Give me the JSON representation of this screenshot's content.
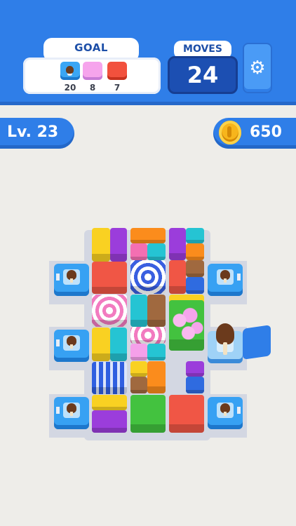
{
  "goal": {
    "label": "GOAL",
    "items": [
      {
        "icon": "ice-cream-goal-icon",
        "count": "20",
        "color": "#3aa6f4"
      },
      {
        "icon": "pink-block-goal-icon",
        "count": "8",
        "color": "#f6a4ec"
      },
      {
        "icon": "red-block-goal-icon",
        "count": "7",
        "color": "#f2513d"
      }
    ]
  },
  "moves": {
    "label": "MOVES",
    "value": "24"
  },
  "settings": {
    "icon": "gear-icon"
  },
  "level": {
    "label": "Lv. 23"
  },
  "coins": {
    "value": "650",
    "icon": "coin-icon"
  },
  "colors": {
    "header": "#2f7ee8",
    "moves_box": "#1c4fb2",
    "background": "#eeede9"
  }
}
